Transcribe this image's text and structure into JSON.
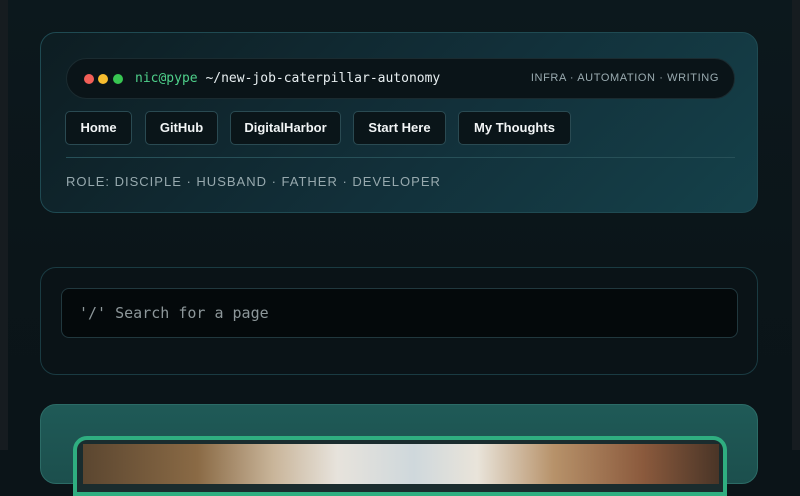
{
  "header": {
    "user": "nic@pype",
    "path": "~/new-job-caterpillar-autonomy",
    "tags": "INFRA · AUTOMATION · WRITING",
    "traffic_lights": {
      "close": "#f25f58",
      "minimize": "#f7bd2f",
      "zoom": "#38c652"
    },
    "nav": [
      {
        "label": "Home"
      },
      {
        "label": "GitHub"
      },
      {
        "label": "DigitalHarbor"
      },
      {
        "label": "Start Here"
      },
      {
        "label": "My Thoughts"
      }
    ],
    "role_line": "ROLE: DISCIPLE · HUSBAND · FATHER · DEVELOPER"
  },
  "search": {
    "placeholder": "'/' Search for a page"
  },
  "colors": {
    "accent_green": "#4ed08a",
    "image_border": "#2fae80",
    "background": "#0b1418"
  }
}
